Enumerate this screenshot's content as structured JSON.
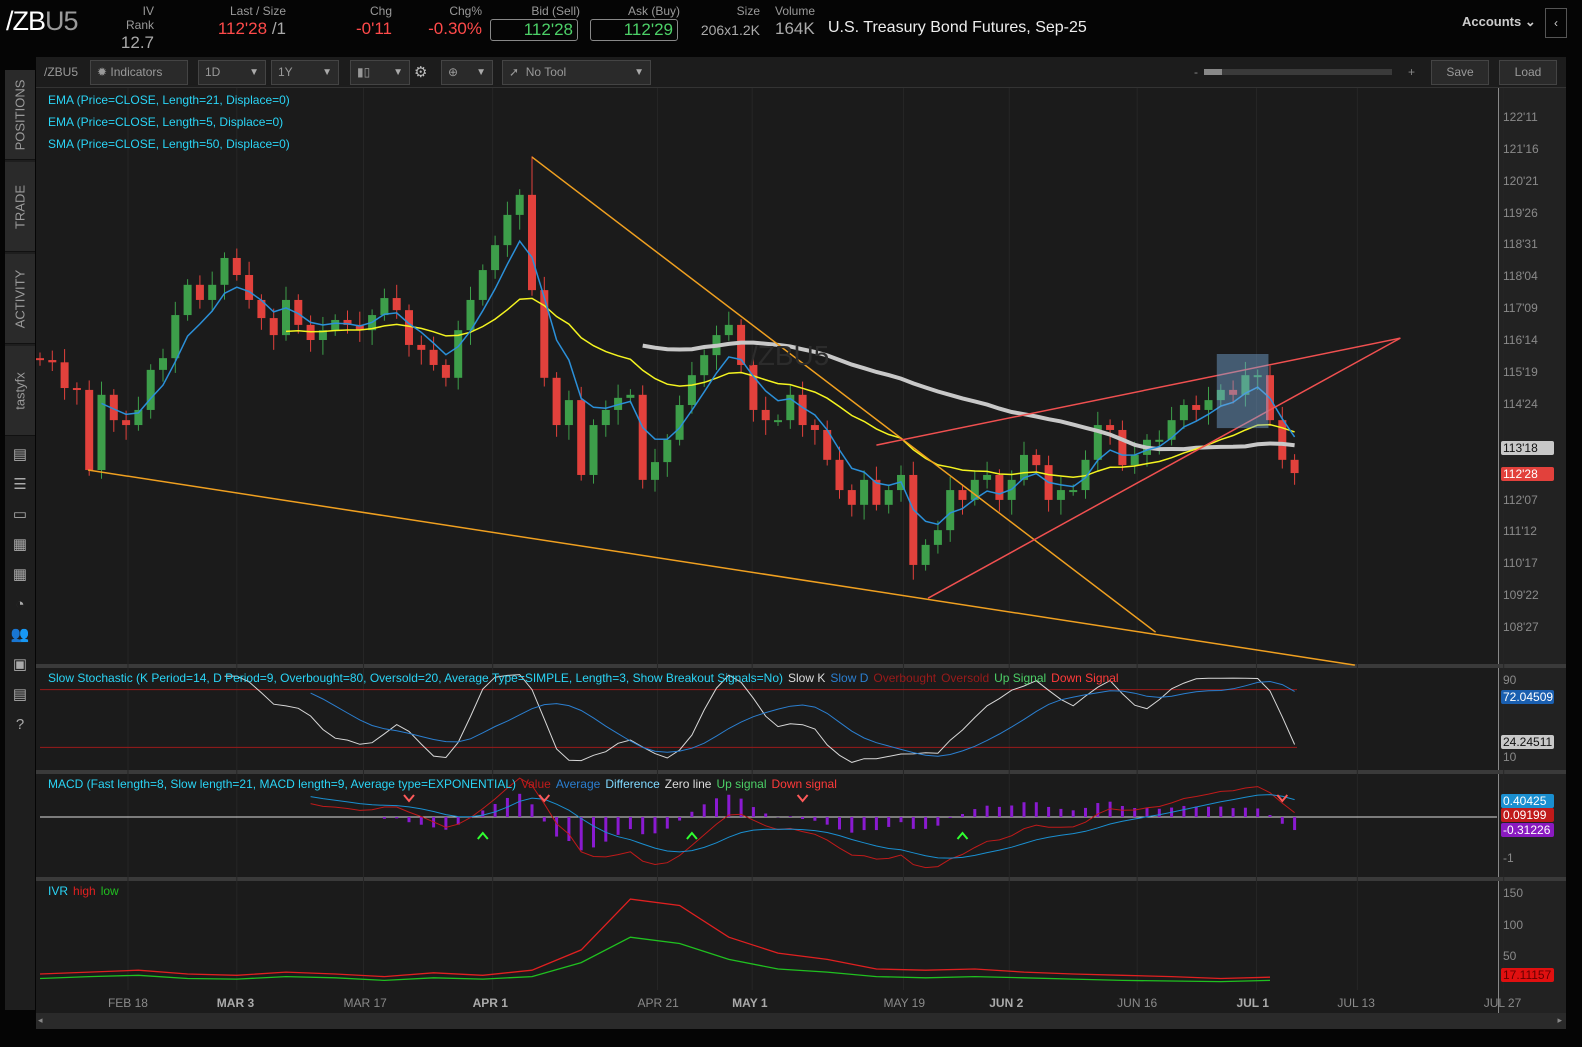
{
  "header": {
    "symbol_main": "/ZB",
    "symbol_suffix": "U5",
    "fields": [
      {
        "label": "IV Rank",
        "value": "12.7"
      },
      {
        "label": "Last / Size",
        "value": "112'28",
        "extra": " /1"
      },
      {
        "label": "Chg",
        "value": "-0'11"
      },
      {
        "label": "Chg%",
        "value": "-0.30%"
      },
      {
        "label": "Bid (Sell)",
        "value": "112'28"
      },
      {
        "label": "Ask (Buy)",
        "value": "112'29"
      },
      {
        "label": "Size",
        "value": "206x1.2K"
      },
      {
        "label": "Volume",
        "value": "164K"
      }
    ],
    "description": "U.S. Treasury Bond Futures, Sep-25",
    "accounts": "Accounts",
    "collapse": "‹"
  },
  "sidebar": {
    "tabs": [
      "POSITIONS",
      "TRADE",
      "ACTIVITY",
      "tastyfx"
    ],
    "icons": [
      "monitor-icon",
      "list-icon",
      "tv-icon",
      "chart-grid-icon",
      "dashboard-icon",
      "gauge-icon",
      "people-icon",
      "calendar-icon",
      "fx-icon",
      "help-icon"
    ],
    "icon_glyphs": [
      "▤",
      "☰",
      "▭",
      "▦",
      "▦",
      "◔",
      "👥",
      "▣",
      "▤",
      "?"
    ]
  },
  "toolbar": {
    "symbol": "/ZBU5",
    "indicators": "Indicators",
    "aggregation": "1D",
    "range": "1Y",
    "tool": "No Tool",
    "zoom_minus": "-",
    "zoom_plus": "+",
    "save": "Save",
    "load": "Load"
  },
  "legends": {
    "price": [
      "EMA (Price=CLOSE, Length=21, Displace=0)",
      "EMA (Price=CLOSE, Length=5, Displace=0)",
      "SMA (Price=CLOSE, Length=50, Displace=0)"
    ],
    "stoch": {
      "title": "Slow Stochastic (K Period=14, D Period=9, Overbought=80, Oversold=20, Average Type=SIMPLE, Length=3, Show Breakout Signals=No)",
      "items": [
        "Slow K",
        "Slow D",
        "Overbought",
        "Oversold",
        "Up Signal",
        "Down Signal"
      ]
    },
    "macd": {
      "title": "MACD (Fast length=8, Slow length=21, MACD length=9, Average type=EXPONENTIAL)",
      "items": [
        "Value",
        "Average",
        "Difference",
        "Zero line",
        "Up signal",
        "Down signal"
      ]
    },
    "ivr": {
      "items": [
        "IVR",
        "high",
        "low"
      ]
    }
  },
  "watermark": "/ZBU5",
  "tags": {
    "price_k": "113'18",
    "price_last": "112'28",
    "stoch_d": "72.04509",
    "stoch_k": "24.24511",
    "macd_avg": "0.40425",
    "macd_val": "0.09199",
    "macd_diff": "-0.31226",
    "ivr": "17.11157"
  },
  "colors": {
    "up": "#3d9e4a",
    "down": "#e2413c",
    "ema21": "#f4f420",
    "ema5": "#2b90d9",
    "sma50": "#c8c8c8",
    "orange": "#f0a020",
    "trend_red": "#f05050"
  },
  "chart_data": {
    "type": "candlestick",
    "closes": [
      115.91,
      115.85,
      115.17,
      115.12,
      113.0,
      114.99,
      114.32,
      114.19,
      114.59,
      115.65,
      115.96,
      117.1,
      117.9,
      117.5,
      117.9,
      118.61,
      118.16,
      117.5,
      117.02,
      116.57,
      117.5,
      116.84,
      116.44,
      116.7,
      116.97,
      116.84,
      116.7,
      117.1,
      117.55,
      117.23,
      116.31,
      116.18,
      115.78,
      115.44,
      116.7,
      117.5,
      118.29,
      118.95,
      119.75,
      120.28,
      117.76,
      115.44,
      114.19,
      114.85,
      112.87,
      114.19,
      114.59,
      114.91,
      114.99,
      112.74,
      113.21,
      113.8,
      114.72,
      115.51,
      116.04,
      116.57,
      116.84,
      115.78,
      114.59,
      114.32,
      114.32,
      114.99,
      114.19,
      114.06,
      113.27,
      112.47,
      112.08,
      112.74,
      112.08,
      112.47,
      112.87,
      110.49,
      111.02,
      111.41,
      112.47,
      112.21,
      112.74,
      112.87,
      112.21,
      112.74,
      113.4,
      113.13,
      112.21,
      112.47,
      112.47,
      113.27,
      114.19,
      114.06,
      113.13,
      113.4,
      113.8,
      113.8,
      114.32,
      114.72,
      114.59,
      114.85,
      115.12,
      114.99,
      115.51,
      115.51,
      114.32,
      113.27,
      112.92
    ],
    "price_ticks": [
      {
        "label": "122'11",
        "v": 122.34375
      },
      {
        "label": "121'16",
        "v": 121.5
      },
      {
        "label": "120'21",
        "v": 120.65625
      },
      {
        "label": "119'26",
        "v": 119.8125
      },
      {
        "label": "118'31",
        "v": 118.96875
      },
      {
        "label": "118'04",
        "v": 118.125
      },
      {
        "label": "117'09",
        "v": 117.28125
      },
      {
        "label": "116'14",
        "v": 116.4375
      },
      {
        "label": "115'19",
        "v": 115.59375
      },
      {
        "label": "114'24",
        "v": 114.75
      },
      {
        "label": "112'07",
        "v": 112.21875
      },
      {
        "label": "111'12",
        "v": 111.375
      },
      {
        "label": "110'17",
        "v": 110.53125
      },
      {
        "label": "109'22",
        "v": 109.6875
      },
      {
        "label": "108'27",
        "v": 108.84375
      }
    ],
    "date_ticks": [
      {
        "label": "FEB 18",
        "bar": 7.15,
        "bold": false
      },
      {
        "label": "MAR 3",
        "bar": 16.0,
        "bold": true
      },
      {
        "label": "MAR 17",
        "bar": 26.3,
        "bold": false
      },
      {
        "label": "APR 1",
        "bar": 36.8,
        "bold": true
      },
      {
        "label": "APR 21",
        "bar": 50.2,
        "bold": false
      },
      {
        "label": "MAY 1",
        "bar": 57.9,
        "bold": true
      },
      {
        "label": "MAY 19",
        "bar": 70.2,
        "bold": false
      },
      {
        "label": "JUN 2",
        "bar": 78.8,
        "bold": true
      },
      {
        "label": "JUN 16",
        "bar": 89.2,
        "bold": false
      },
      {
        "label": "JUL 1",
        "bar": 98.9,
        "bold": true
      },
      {
        "label": "JUL 13",
        "bar": 107.1,
        "bold": false
      },
      {
        "label": "JUL 27",
        "bar": 119.0,
        "bold": false
      }
    ],
    "trendlines": [
      {
        "color": "orange",
        "from": [
          3.9,
          113.0
        ],
        "to": [
          106.9,
          107.84
        ]
      },
      {
        "color": "orange",
        "from": [
          40,
          121.28
        ],
        "to": [
          90.7,
          108.71
        ]
      },
      {
        "color": "red",
        "from": [
          68,
          113.66
        ],
        "to": [
          110.6,
          116.49
        ]
      },
      {
        "color": "red",
        "from": [
          72.2,
          109.61
        ],
        "to": [
          110.6,
          116.49
        ]
      }
    ],
    "box": {
      "bars": [
        96,
        100.2
      ],
      "prices": [
        116.07,
        114.11
      ]
    },
    "stoch_ticks": [
      {
        "label": "90",
        "v": 90
      },
      {
        "label": "10",
        "v": 10
      }
    ],
    "macd_ticks": [
      {
        "label": "-1",
        "v": -1
      }
    ],
    "macd_signals": [
      {
        "bar": 30,
        "type": "down"
      },
      {
        "bar": 41,
        "type": "down"
      },
      {
        "bar": 62,
        "type": "down"
      },
      {
        "bar": 101,
        "type": "down"
      },
      {
        "bar": 36,
        "type": "up"
      },
      {
        "bar": 53,
        "type": "up"
      },
      {
        "bar": 75,
        "type": "up"
      }
    ],
    "ivr_ticks": [
      {
        "label": "150",
        "v": 150
      },
      {
        "label": "100",
        "v": 100
      },
      {
        "label": "50",
        "v": 50
      }
    ],
    "ivr_step": 4,
    "ivr_high": [
      22,
      25,
      28,
      22,
      20,
      25,
      22,
      18,
      24,
      20,
      28,
      60,
      140,
      130,
      80,
      55,
      45,
      30,
      28,
      30,
      25,
      22,
      20,
      18,
      15,
      17
    ],
    "ivr_low": [
      15,
      18,
      20,
      15,
      14,
      18,
      16,
      12,
      16,
      14,
      18,
      40,
      80,
      70,
      45,
      30,
      25,
      18,
      16,
      18,
      16,
      14,
      12,
      11,
      10,
      12
    ]
  }
}
